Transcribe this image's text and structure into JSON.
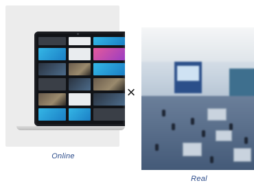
{
  "captions": {
    "online": "Online",
    "real": "Real"
  },
  "comparison": {
    "separator_icon": "times-icon",
    "separator_glyph": "×"
  },
  "colors": {
    "caption": "#2b4b8a",
    "card_bg": "#ececec"
  }
}
